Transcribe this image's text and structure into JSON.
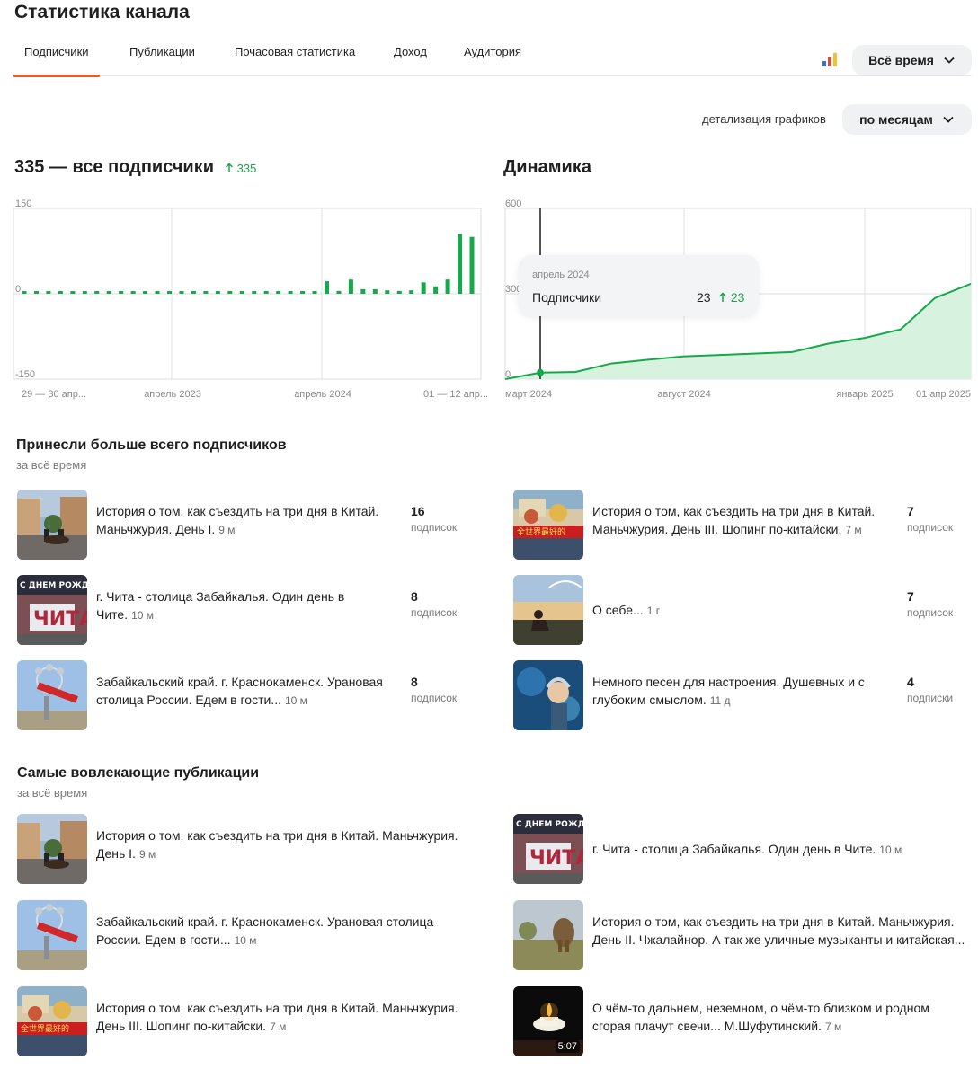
{
  "page_title": "Статистика канала",
  "tabs": [
    {
      "label": "Подписчики",
      "active": true
    },
    {
      "label": "Публикации",
      "active": false
    },
    {
      "label": "Почасовая статистика",
      "active": false
    },
    {
      "label": "Доход",
      "active": false
    },
    {
      "label": "Аудитория",
      "active": false
    }
  ],
  "period_select": {
    "value": "Всё время"
  },
  "detail": {
    "label": "детализация графиков",
    "value": "по месяцам"
  },
  "subscribers": {
    "total": "335",
    "title_suffix": " — все подписчики",
    "growth": "335"
  },
  "dynamics": {
    "title": "Динамика"
  },
  "tooltip": {
    "date": "апрель 2024",
    "label": "Подписчики",
    "value": "23",
    "growth": "23"
  },
  "colors": {
    "accent": "#ea5a2a",
    "green": "#1aa34a",
    "bar_green": "#16a84a",
    "area_green": "#d7f3df"
  },
  "chart_data": [
    {
      "type": "bar",
      "ylim": [
        -150,
        150
      ],
      "yticks": [
        "150",
        "0",
        "-150"
      ],
      "xticks": [
        "29 — 30 апр...",
        "апрель 2023",
        "апрель 2024",
        "01 — 12 апр..."
      ],
      "values": [
        0,
        0,
        0,
        0,
        0,
        0,
        0,
        0,
        0,
        0,
        0,
        0,
        0,
        0,
        0,
        0,
        0,
        0,
        0,
        0,
        0,
        0,
        0,
        0,
        0,
        22,
        5,
        25,
        8,
        8,
        6,
        5,
        6,
        20,
        13,
        25,
        105,
        100
      ],
      "grid": true
    },
    {
      "type": "area",
      "ylim": [
        0,
        600
      ],
      "yticks": [
        "600",
        "300",
        "0"
      ],
      "xticks": [
        "март 2024",
        "август 2024",
        "январь 2025",
        "01 апр 2025"
      ],
      "points": [
        {
          "x": "март 2024",
          "y": 0
        },
        {
          "x": "апрель 2024",
          "y": 23
        },
        {
          "x": "май 2024",
          "y": 25
        },
        {
          "x": "июнь 2024",
          "y": 55
        },
        {
          "x": "июль 2024",
          "y": 68
        },
        {
          "x": "август 2024",
          "y": 80
        },
        {
          "x": "сентябрь 2024",
          "y": 85
        },
        {
          "x": "октябрь 2024",
          "y": 90
        },
        {
          "x": "ноябрь 2024",
          "y": 95
        },
        {
          "x": "декабрь 2024",
          "y": 125
        },
        {
          "x": "январь 2025",
          "y": 145
        },
        {
          "x": "февраль 2025",
          "y": 175
        },
        {
          "x": "март 2025",
          "y": 285
        },
        {
          "x": "01 апр 2025",
          "y": 335
        }
      ],
      "grid": true
    }
  ],
  "top_subscribers": {
    "title": "Принесли больше всего подписчиков",
    "subtitle": "за всё время",
    "items": [
      {
        "title1": "История о том, как съездить на три дня в Китай.",
        "title2": "Маньчжурия. День I.",
        "age": "9 м",
        "count": "16",
        "unit": "подписок",
        "thumb": "street"
      },
      {
        "title1": "История о том, как съездить на три дня в Китай.",
        "title2": "Маньчжурия. День III. Шопинг по-китайски.",
        "age": "7 м",
        "count": "7",
        "unit": "подписок",
        "thumb": "shop"
      },
      {
        "title1": "г. Чита - столица Забайкалья. Один день в",
        "title2": "Чите.",
        "age": "10 м",
        "count": "8",
        "unit": "подписок",
        "thumb": "chita"
      },
      {
        "title1": "О себе...",
        "title2": "",
        "age": "1 г",
        "count": "7",
        "unit": "подписок",
        "thumb": "sunset"
      },
      {
        "title1": "Забайкальский край. г. Краснокаменск. Урановая",
        "title2": "столица России. Едем в гости...",
        "age": "10 м",
        "count": "8",
        "unit": "подписок",
        "thumb": "monument"
      },
      {
        "title1": "Немного песен для настроения. Душевных и с",
        "title2": "глубоким смыслом.",
        "age": "11 д",
        "count": "4",
        "unit": "подписки",
        "thumb": "music"
      }
    ]
  },
  "top_engaging": {
    "title": "Самые вовлекающие публикации",
    "subtitle": "за всё время",
    "items": [
      {
        "title1": "История о том, как съездить на три дня в Китай. Маньчжурия.",
        "title2": "День I.",
        "age": "9 м",
        "thumb": "street",
        "duration": ""
      },
      {
        "title1": "г. Чита - столица Забайкалья. Один день в Чите.",
        "title2": "",
        "age": "10 м",
        "thumb": "chita",
        "duration": ""
      },
      {
        "title1": "Забайкальский край. г. Краснокаменск. Урановая столица",
        "title2": "России. Едем в гости...",
        "age": "10 м",
        "thumb": "monument",
        "duration": ""
      },
      {
        "title1": "История о том, как съездить на три дня в Китай. Маньчжурия.",
        "title2": "День II. Чжалайнор. А так же уличные музыканты и китайская...",
        "age": "",
        "thumb": "elephant",
        "duration": ""
      },
      {
        "title1": "История о том, как съездить на три дня в Китай. Маньчжурия.",
        "title2": "День III. Шопинг по-китайски.",
        "age": "7 м",
        "thumb": "shop",
        "duration": ""
      },
      {
        "title1": "О чём-то дальнем, неземном, о чём-то близком и родном",
        "title2": "сгорая плачут свечи... М.Шуфутинский.",
        "age": "7 м",
        "thumb": "candle",
        "duration": "5:07"
      }
    ]
  }
}
